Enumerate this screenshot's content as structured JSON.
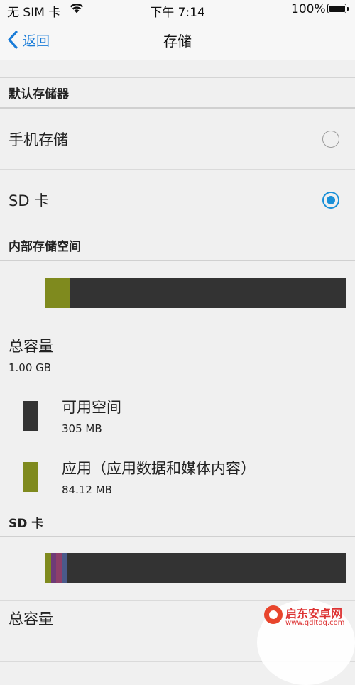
{
  "status_bar": {
    "carrier": "无 SIM 卡",
    "time": "下午 7:14",
    "battery_percent": "100%",
    "battery_level": 1.0,
    "icons": [
      "wifi-icon",
      "battery-icon"
    ]
  },
  "nav": {
    "back_label": "返回",
    "title": "存储",
    "back_icon": "chevron-left-icon",
    "accent_color": "#1a7cd8"
  },
  "default_storage": {
    "header": "默认存储器",
    "options": [
      {
        "label": "手机存储",
        "selected": false
      },
      {
        "label": "SD 卡",
        "selected": true
      }
    ]
  },
  "internal": {
    "header": "内部存储空间",
    "usage_bar": [
      {
        "name": "应用",
        "color": "#7f8a1e",
        "fraction": 0.083
      }
    ],
    "bar_background": "#333333",
    "total_label": "总容量",
    "total_value": "1.00 GB",
    "items": [
      {
        "label": "可用空间",
        "value": "305 MB",
        "color": "#333333"
      },
      {
        "label": "应用（应用数据和媒体内容）",
        "value": "84.12 MB",
        "color": "#7f8a1e"
      }
    ]
  },
  "sd_card": {
    "header": "SD 卡",
    "usage_bar": [
      {
        "color": "#7f8a1e",
        "fraction": 0.018
      },
      {
        "color": "#6e3b78",
        "fraction": 0.018
      },
      {
        "color": "#8e3f6a",
        "fraction": 0.018
      },
      {
        "color": "#4a5a8a",
        "fraction": 0.018
      }
    ],
    "total_label": "总容量"
  },
  "watermark": {
    "name": "启东安卓网",
    "url": "www.qdltdq.com"
  }
}
